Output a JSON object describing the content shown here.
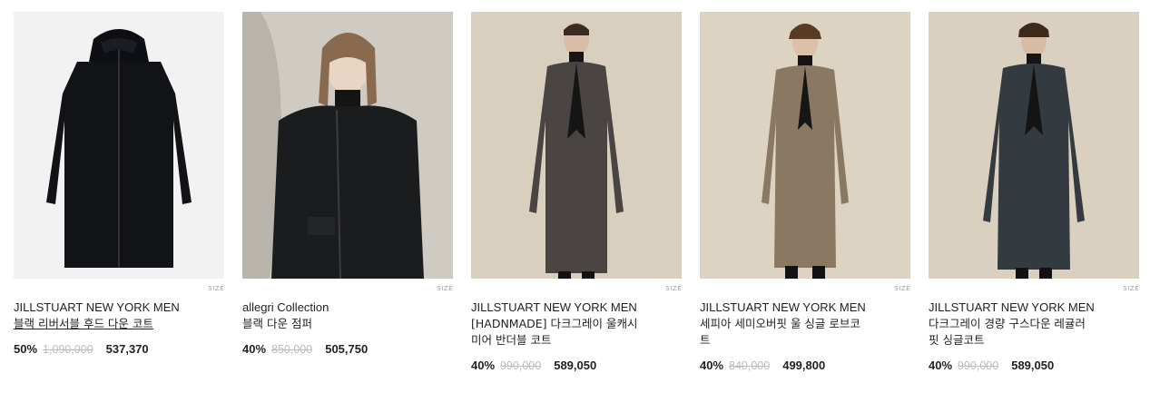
{
  "size_label": "SIZE",
  "products": [
    {
      "brand": "JILLSTUART NEW YORK MEN",
      "name_lines": [
        "블랙 리버서블 후드 다운 코트"
      ],
      "discount": "50%",
      "original_price": "1,090,000",
      "sale_price": "537,370",
      "image": "black-hooded-down-coat-flatlay",
      "bg_color": "#f2f2f2"
    },
    {
      "brand": "allegri Collection",
      "name_lines": [
        "블랙 다운 점퍼"
      ],
      "discount": "40%",
      "original_price": "850,000",
      "sale_price": "505,750",
      "image": "model-black-down-jumper",
      "bg_color": "#c9c5bd"
    },
    {
      "brand": "JILLSTUART NEW YORK MEN",
      "name_lines": [
        "[HADNMADE] 다크그레이 울캐시",
        "미어 반더블 코트"
      ],
      "discount": "40%",
      "original_price": "990,000",
      "sale_price": "589,050",
      "image": "model-dark-grey-coat",
      "bg_color": "#d8cfbe"
    },
    {
      "brand": "JILLSTUART NEW YORK MEN",
      "name_lines": [
        "세피아 세미오버핏 울 싱글 로브코",
        "트"
      ],
      "discount": "40%",
      "original_price": "840,000",
      "sale_price": "499,800",
      "image": "model-sepia-robe-coat",
      "bg_color": "#ddd3c3"
    },
    {
      "brand": "JILLSTUART NEW YORK MEN",
      "name_lines": [
        "다크그레이 경량 구스다운 레귤러",
        "핏 싱글코트"
      ],
      "discount": "40%",
      "original_price": "990,000",
      "sale_price": "589,050",
      "image": "model-dark-grey-down-coat",
      "bg_color": "#d9d0c0"
    }
  ]
}
